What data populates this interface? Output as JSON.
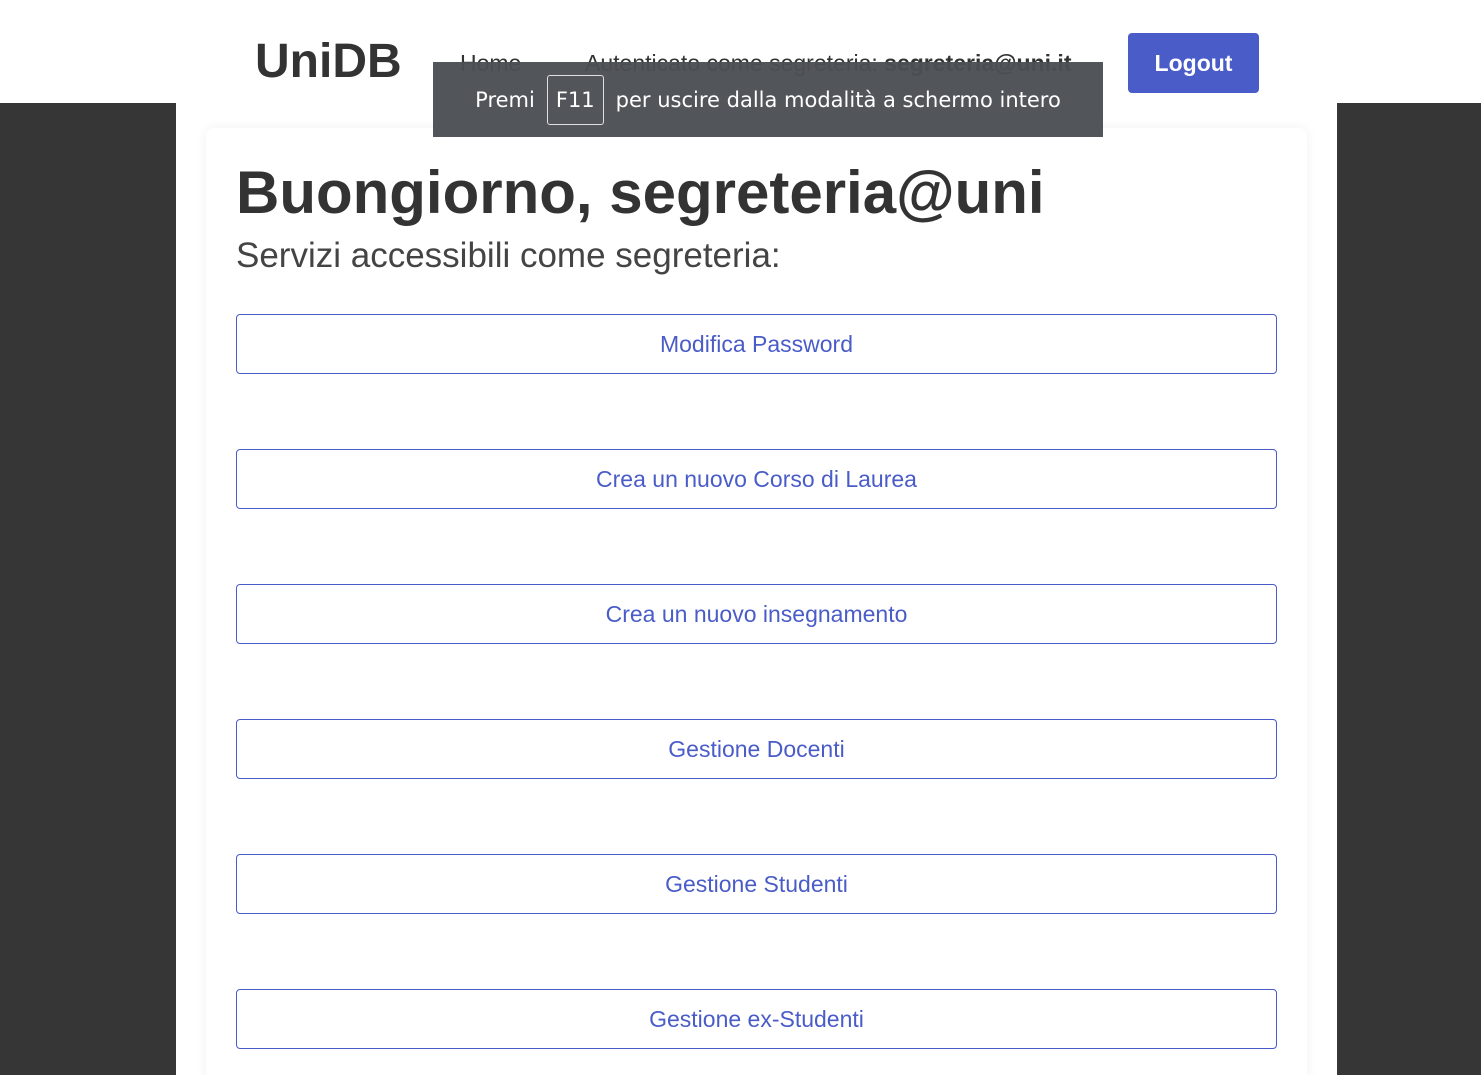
{
  "header": {
    "logo": "UniDB",
    "nav_home": "Home",
    "auth_prefix": "Autenticato come segreteria: ",
    "auth_user": "segreteria@uni.it",
    "logout_label": "Logout"
  },
  "fullscreen_notice": {
    "prefix": "Premi",
    "key": "F11",
    "suffix": "per uscire dalla modalità a schermo intero"
  },
  "main": {
    "greeting": "Buongiorno, segreteria@uni",
    "subtitle": "Servizi accessibili come segreteria:",
    "services": [
      {
        "label": "Modifica Password"
      },
      {
        "label": "Crea un nuovo Corso di Laurea"
      },
      {
        "label": "Crea un nuovo insegnamento"
      },
      {
        "label": "Gestione Docenti"
      },
      {
        "label": "Gestione Studenti"
      },
      {
        "label": "Gestione ex-Studenti"
      }
    ]
  },
  "colors": {
    "accent": "#4a5cc7",
    "dark_background": "#363636",
    "text": "#333333"
  }
}
